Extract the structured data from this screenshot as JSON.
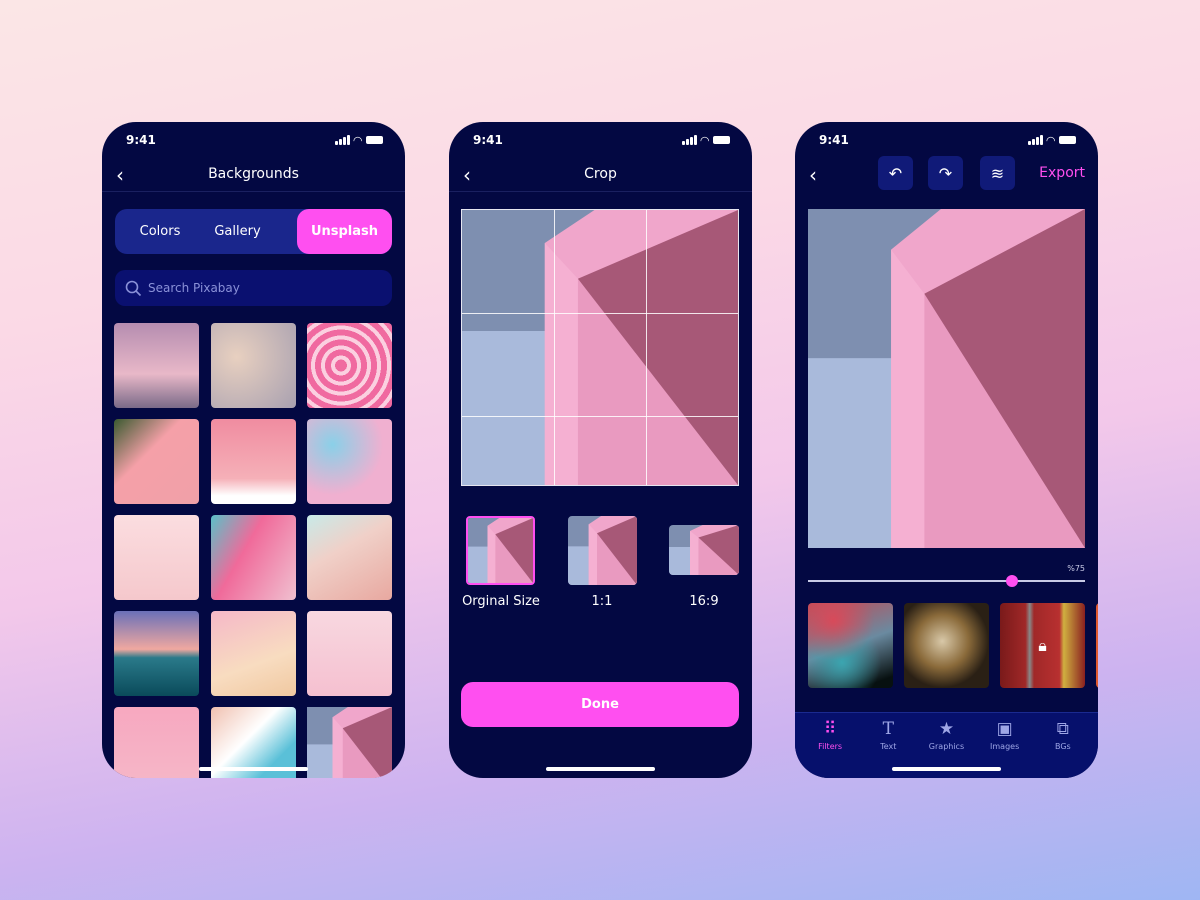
{
  "status": {
    "time": "9:41"
  },
  "backgrounds": {
    "title": "Backgrounds",
    "tabs": [
      {
        "label": "Colors",
        "active": false
      },
      {
        "label": "Gallery",
        "active": false
      },
      {
        "label": "Unsplash",
        "active": true
      }
    ],
    "search_placeholder": "Search Pixabay"
  },
  "crop": {
    "title": "Crop",
    "ratios": [
      {
        "label": "Orginal Size",
        "selected": true
      },
      {
        "label": "1:1",
        "selected": false
      },
      {
        "label": "16:9",
        "selected": false
      }
    ],
    "done_label": "Done"
  },
  "editor": {
    "export_label": "Export",
    "slider_label": "%75",
    "slider_value": 0.75,
    "filters": [
      {
        "name": "fluid-red-teal",
        "locked": false
      },
      {
        "name": "marble-gold",
        "locked": false
      },
      {
        "name": "arches-red",
        "locked": true
      }
    ],
    "nav": [
      {
        "label": "Filters",
        "icon": "grid-icon",
        "active": true
      },
      {
        "label": "Text",
        "icon": "text-icon",
        "active": false
      },
      {
        "label": "Graphics",
        "icon": "star-icon",
        "active": false
      },
      {
        "label": "Images",
        "icon": "image-icon",
        "active": false
      },
      {
        "label": "BGs",
        "icon": "layers-squares-icon",
        "active": false
      }
    ]
  },
  "colors": {
    "accent": "#ff4ff0",
    "phone_bg": "#030842",
    "segment_bg": "#1a268c"
  }
}
